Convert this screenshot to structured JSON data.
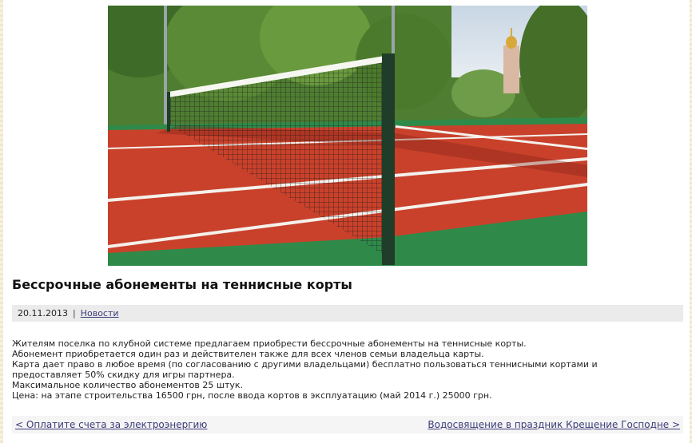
{
  "post": {
    "image_alt": "Теннисный корт с сеткой",
    "title": "Бессрочные абонементы на теннисные корты",
    "date": "20.11.2013",
    "separator": "|",
    "category": "Новости",
    "paragraphs": [
      "Жителям поселка по клубной системе предлагаем приобрести бессрочные абонементы на теннисные корты.",
      "Абонемент приобретается один раз и действителен также для всех членов семьи владельца карты.",
      "Карта дает право в любое время (по согласованию с другими владельцами) бесплатно пользоваться теннисными кортами и предоставляет 50% скидку для игры партнера.",
      "Максимальное количество абонементов 25 штук.",
      "Цена: на этапе строительства 16500 грн, после ввода кортов в эксплуатацию (май 2014 г.) 25000 грн."
    ]
  },
  "navigation": {
    "prev_label": "< Оплатите счета за электроэнергию",
    "next_label": "Водосвящение в праздник Крещение Господне >"
  },
  "colors": {
    "link": "#3c3c7a",
    "meta_bar_bg": "#ebebeb",
    "court_red": "#c9412b",
    "court_green": "#2f8a4a"
  }
}
